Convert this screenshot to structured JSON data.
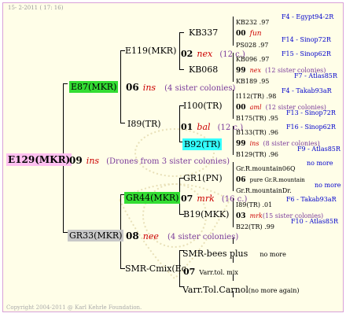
{
  "header": {
    "text": "15-  2-2011 ( 17: 16)"
  },
  "footer": {
    "text": "Copyright 2004-2011 @ Karl Kehrle Foundation."
  },
  "root": {
    "name": "E129(MKR)",
    "year": "09",
    "sym": "ins",
    "note": "(Drones from 3 sister colonies)"
  },
  "father": {
    "name": "E87(MKR)",
    "year": "06",
    "sym": "ins",
    "note": "(4 sister colonies)"
  },
  "mother": {
    "name": "GR33(MKR)",
    "year": "08",
    "sym": "nee",
    "note": "(4 sister colonies)"
  },
  "ff": {
    "name": "E119(MKR)",
    "year": "02",
    "sym": "nex",
    "note": "(12 c.)"
  },
  "fm": {
    "name": "I89(TR)",
    "year": "01",
    "sym": "bal",
    "note": "(12 c.)"
  },
  "mf": {
    "name": "GR44(MKR)",
    "year": "07",
    "sym": "mrk",
    "note": "(16 c.)"
  },
  "mm": {
    "name": "SMR-Cmix(Ec",
    "year": "07",
    "note": "Varr.tol. mix"
  },
  "fff": {
    "name": "KB337"
  },
  "ffm": {
    "name": "KB068"
  },
  "fmf": {
    "name": "I100(TR)"
  },
  "fmm": {
    "name": "B92(TR)"
  },
  "mff": {
    "name": "GR1(PN)"
  },
  "mfm": {
    "name": "B19(MKK)"
  },
  "mmf": {
    "name": "SMR-bees plus",
    "note": "no more"
  },
  "mmm": {
    "name": "Varr.Tol.Carnol",
    "note": "(no more again)"
  },
  "leaves": [
    {
      "name": "KB232 .97",
      "loc": "F4 - Egypt94-2R"
    },
    {
      "yr": "00",
      "sym": "fun"
    },
    {
      "name": "PS028 .97",
      "loc": "F14 - Sinop72R"
    },
    {
      "name": "KB096 .97",
      "loc": "F15 - Sinop62R"
    },
    {
      "yr": "99",
      "sym": "nex",
      "note": "(12 sister colonies)"
    },
    {
      "name": "KB189 .95",
      "loc": "F7 - Atlas85R"
    },
    {
      "name": "I112(TR) .98",
      "loc": "F4 - Takab93aR"
    },
    {
      "yr": "00",
      "sym": "aml",
      "note": "(12 sister colonies)"
    },
    {
      "name": "B175(TR) .95",
      "loc": "F13 - Sinop72R"
    },
    {
      "name": "B133(TR) .96",
      "loc": "F16 - Sinop62R"
    },
    {
      "yr": "99",
      "sym": "ins",
      "note": "(8 sister colonies)"
    },
    {
      "name": "B129(TR) .96",
      "loc": "F9 - Atlas85R"
    },
    {
      "name": "Gr.R.mountain06Q",
      "loc": "no more"
    },
    {
      "yr": "06",
      "note": "pure Gr.R.mountain"
    },
    {
      "name": "Gr.R.mountainDr.",
      "loc": "no more"
    },
    {
      "name": "I89(TR) .01",
      "loc": "F6 - Takab93aR"
    },
    {
      "yr": "03",
      "sym": "mrk",
      "note": "(15 sister colonies)"
    },
    {
      "name": "B22(TR) .99",
      "loc": "F10 - Atlas85R"
    }
  ]
}
